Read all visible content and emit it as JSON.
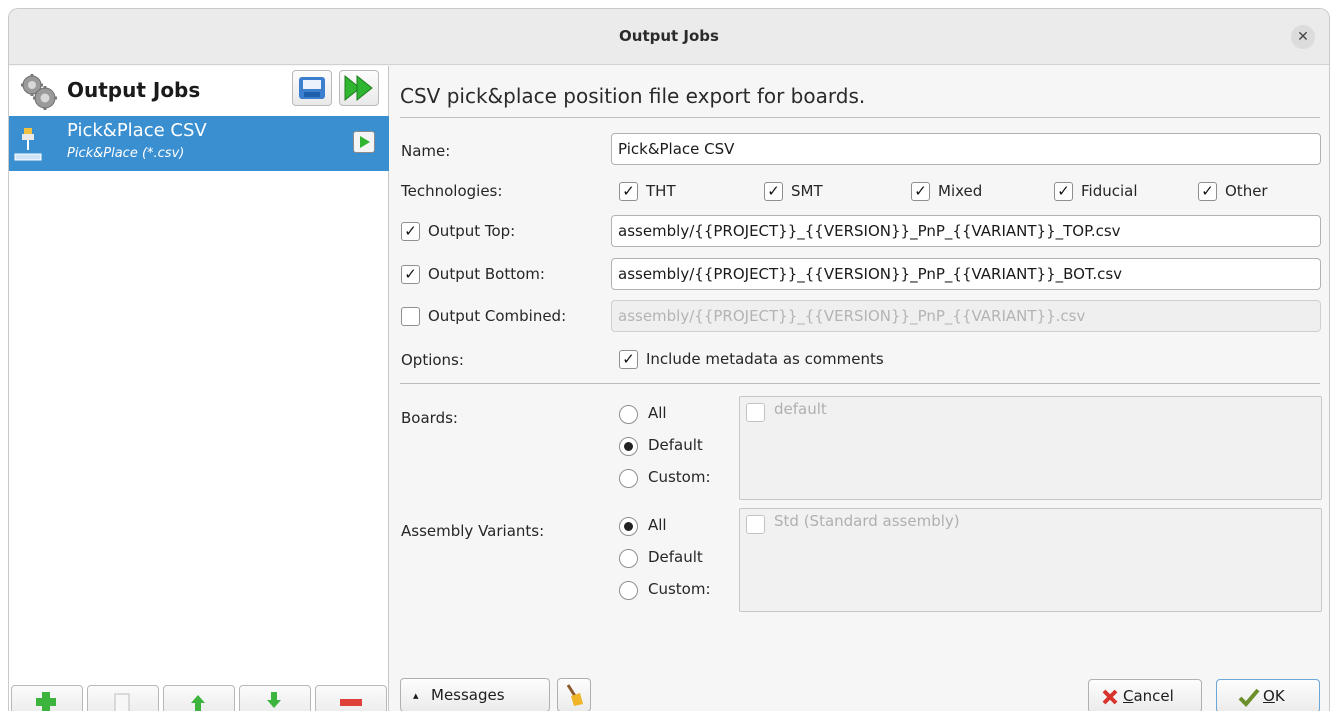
{
  "window": {
    "title": "Output Jobs",
    "close_glyph": "✕"
  },
  "left_panel": {
    "title": "Output Jobs",
    "toolbar": [
      {
        "icon": "save-icon"
      },
      {
        "icon": "run-all-icon"
      }
    ],
    "jobs": [
      {
        "name": "Pick&Place CSV",
        "type": "Pick&Place (*.csv)",
        "selected": true
      }
    ],
    "bottom_buttons": [
      {
        "icon": "add-icon"
      },
      {
        "icon": "copy-icon"
      },
      {
        "icon": "move-up-icon"
      },
      {
        "icon": "move-down-icon"
      },
      {
        "icon": "remove-icon"
      }
    ]
  },
  "editor": {
    "description": "CSV pick&place position file export for boards.",
    "name_label": "Name:",
    "name_value": "Pick&Place CSV",
    "technologies_label": "Technologies:",
    "technologies": [
      {
        "label": "THT",
        "checked": true
      },
      {
        "label": "SMT",
        "checked": true
      },
      {
        "label": "Mixed",
        "checked": true
      },
      {
        "label": "Fiducial",
        "checked": true
      },
      {
        "label": "Other",
        "checked": true
      }
    ],
    "output_top": {
      "label": "Output Top:",
      "checked": true,
      "value": "assembly/{{PROJECT}}_{{VERSION}}_PnP_{{VARIANT}}_TOP.csv"
    },
    "output_bottom": {
      "label": "Output Bottom:",
      "checked": true,
      "value": "assembly/{{PROJECT}}_{{VERSION}}_PnP_{{VARIANT}}_BOT.csv"
    },
    "output_combined": {
      "label": "Output Combined:",
      "checked": false,
      "value": "assembly/{{PROJECT}}_{{VERSION}}_PnP_{{VARIANT}}.csv"
    },
    "options_label": "Options:",
    "options": [
      {
        "label": "Include metadata as comments",
        "checked": true
      }
    ],
    "boards": {
      "label": "Boards:",
      "radios": [
        {
          "label": "All",
          "selected": false
        },
        {
          "label": "Default",
          "selected": true
        },
        {
          "label": "Custom:",
          "selected": false
        }
      ],
      "items": [
        {
          "label": "default",
          "checked": false
        }
      ]
    },
    "assembly_variants": {
      "label": "Assembly Variants:",
      "radios": [
        {
          "label": "All",
          "selected": true
        },
        {
          "label": "Default",
          "selected": false
        },
        {
          "label": "Custom:",
          "selected": false
        }
      ],
      "items": [
        {
          "label": "Std (Standard assembly)",
          "checked": false
        }
      ]
    }
  },
  "footer": {
    "messages_label": "Messages",
    "messages_glyph": "▴",
    "cancel_prefix": "",
    "cancel_mnemonic": "C",
    "cancel_rest": "ancel",
    "ok_mnemonic": "O",
    "ok_rest": "K"
  },
  "colors": {
    "selection": "#3a8fd1",
    "run_green": "#2fb52f",
    "add_green": "#3db43d",
    "remove_red": "#e0403a"
  }
}
